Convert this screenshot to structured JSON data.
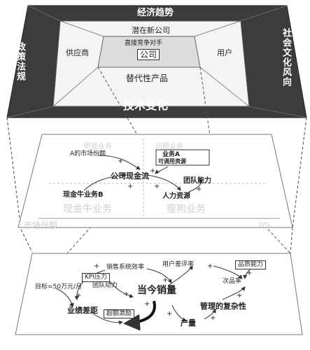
{
  "top_layer": {
    "outer_top": "经济趋势",
    "outer_left": "政策法规",
    "outer_right": "社会文化风向",
    "outer_bottom": "技术变化",
    "inner_top": "潜在新公司",
    "inner_left": "供应商",
    "inner_right": "用户",
    "inner_bottom": "替代性产品",
    "center_caption": "直接竞争对手",
    "center_box": "公司"
  },
  "middle_layer": {
    "q_top_left": "明星业务",
    "q_top_right": "问题业务",
    "q_bottom_left": "现金牛业务",
    "q_bottom_right": "瘦狗业务",
    "market_share": "市场份额",
    "zero_percent": "0%",
    "node_a_share": "A的市场份额",
    "node_cash_flow": "公司现金流",
    "node_cash_cow_b": "现金牛业务B",
    "node_human": "人力资源",
    "node_team": "团队能力",
    "node_biz_a_line1": "业务A",
    "node_biz_a_line2": "可调用资源",
    "signs": [
      "+",
      "+",
      "+",
      "+",
      "+"
    ]
  },
  "bottom_layer": {
    "kpi": "KPI压力",
    "sales_eff": "销售系统效率",
    "team_drive": "团队动力",
    "target": "目标=50万元/月",
    "perf_gap": "业绩差距",
    "overtime": "超额激励",
    "current_sales": "当今销量",
    "user_review": "用户差评率",
    "product_cap": "品质能力",
    "defect": "次品率",
    "output": "产量",
    "complexity": "管理的复杂性",
    "signs": [
      "+",
      "+",
      "+",
      "+",
      "+",
      "+",
      "+",
      "+",
      "+",
      "+",
      "+"
    ]
  }
}
